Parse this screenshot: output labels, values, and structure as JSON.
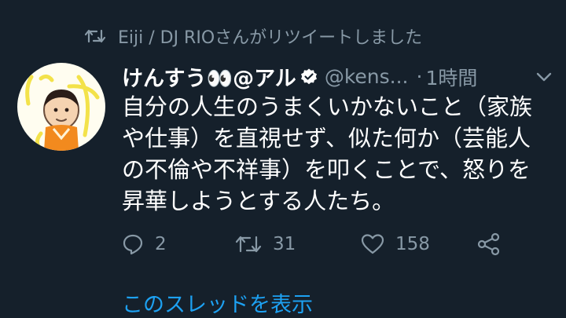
{
  "retweet_notice": {
    "icon": "retweet-icon",
    "text": "Eiji / DJ RIOさんがリツイートしました"
  },
  "tweet": {
    "display_name": "けんすう👀@アル",
    "handle": "@kens...",
    "separator": "·",
    "time": "1時間",
    "text": "自分の人生のうまくいかないこと（家族や仕事）を直視せず、似た何か（芸能人の不倫や不祥事）を叩くことで、怒りを昇華しようとする人たち。"
  },
  "actions": {
    "reply_count": "2",
    "retweet_count": "31",
    "like_count": "158"
  },
  "thread_link": "このスレッドを表示",
  "colors": {
    "background": "#15202b",
    "secondary_text": "#8899a6",
    "link": "#1da1f2",
    "verified_badge": "#ffffff"
  }
}
